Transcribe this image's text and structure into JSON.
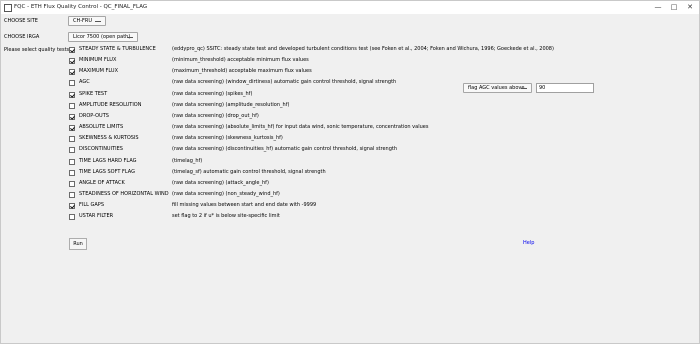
{
  "window": {
    "title": "FQC - ETH Flux Quality Control - QC_FINAL_FLAG",
    "minimize": "—",
    "maximize": "□",
    "close": "✕"
  },
  "site": {
    "label": "CHOOSE SITE",
    "value": "CH-FRU"
  },
  "irga": {
    "label": "CHOOSE IRGA",
    "value": "Licor 7500 (open path)"
  },
  "tests_label": "Please select quality tests:",
  "tests": [
    {
      "name": "STEADY STATE & TURBULENCE",
      "checked": true,
      "description": "(eddypro_qc) SSITC: steady state test and developed turbulent conditions test (see Foken et al., 2004; Foken and Wichura, 1996; Goeckede et al., 2008)"
    },
    {
      "name": "MINIMUM FLUX",
      "checked": true,
      "description": "(minimum_threshold) acceptable minimum flux values"
    },
    {
      "name": "MAXIMUM FLUX",
      "checked": true,
      "description": "(maximum_threshold) acceptable maximum flux values"
    },
    {
      "name": "AGC",
      "checked": false,
      "description": "(raw data screening) (window_dirtiness) automatic gain control threshold, signal strength"
    },
    {
      "name": "SPIKE TEST",
      "checked": true,
      "description": "(raw data screening) (spikes_hf)"
    },
    {
      "name": "AMPLITUDE RESOLUTION",
      "checked": false,
      "description": "(raw data screening) (amplitude_resolution_hf)"
    },
    {
      "name": "DROP-OUTS",
      "checked": true,
      "description": "(raw data screening) (drop_out_hf)"
    },
    {
      "name": "ABSOLUTE LIMITS",
      "checked": true,
      "description": "(raw data screening) (absolute_limits_hf) for input data wind, sonic temperature, concentration values"
    },
    {
      "name": "SKEWNESS & KURTOSIS",
      "checked": false,
      "description": "(raw data screening) (skewness_kurtosis_hf)"
    },
    {
      "name": "DISCONTINUITIES",
      "checked": false,
      "description": "(raw data screening) (discontinuities_hf) automatic gain control threshold, signal strength"
    },
    {
      "name": "TIME LAGS HARD FLAG",
      "checked": false,
      "description": "(timelag_hf)"
    },
    {
      "name": "TIME LAGS SOFT FLAG",
      "checked": false,
      "description": "(timelag_sf) automatic gain control threshold, signal strength"
    },
    {
      "name": "ANGLE OF ATTACK",
      "checked": false,
      "description": "(raw data screening) (attack_angle_hf)"
    },
    {
      "name": "STEADINESS OF HORIZONTAL WIND",
      "checked": false,
      "description": "(raw data screening) (non_steady_wind_hf)"
    },
    {
      "name": "FILL GAPS",
      "checked": true,
      "description": "fill missing values between start and end date with -9999"
    },
    {
      "name": "USTAR FILTER",
      "checked": false,
      "description": "set flag to 2 if u* is below site-specific limit"
    }
  ],
  "agc": {
    "mode": "flag AGC values above",
    "threshold": "90"
  },
  "run_label": "Run",
  "help_label": "Help"
}
